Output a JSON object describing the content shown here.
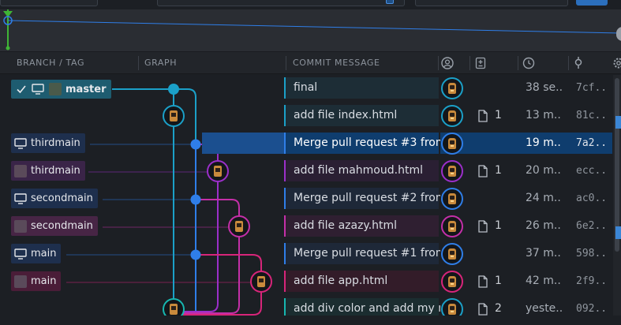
{
  "header": {
    "branch_tag": "BRANCH / TAG",
    "graph": "GRAPH",
    "commit_message": "COMMIT MESSAGE",
    "author_icon": "person-circle-icon",
    "changes_icon": "file-diff-icon",
    "datetime_icon": "clock-icon",
    "sha_icon": "commit-icon",
    "settings_icon": "gear-icon"
  },
  "refs": {
    "master": "master",
    "thirdmain_local": "thirdmain",
    "thirdmain_remote": "thirdmain",
    "secondmain_local": "secondmain",
    "secondmain_remote": "secondmain",
    "main_local": "main",
    "main_remote": "main"
  },
  "colors": {
    "lane_cyan": "#1ba0c8",
    "lane_blue": "#2f7ee8",
    "lane_purple": "#9b2fc9",
    "lane_magenta": "#c42fa8",
    "lane_pink": "#d8257a",
    "lane_teal": "#17b7b0",
    "selection": "#0f3d6e"
  },
  "commits": [
    {
      "message": "final",
      "files": "",
      "time": "38 se...",
      "sha": "7cf..."
    },
    {
      "message": "add file index.html",
      "files": "1",
      "time": "13 m...",
      "sha": "81c..."
    },
    {
      "message": "Merge pull request #3 from",
      "files": "",
      "time": "19 m...",
      "sha": "7a2..."
    },
    {
      "message": "add file mahmoud.html",
      "files": "1",
      "time": "20 m...",
      "sha": "ecc..."
    },
    {
      "message": "Merge pull request #2 from",
      "files": "",
      "time": "24 m...",
      "sha": "ac0..."
    },
    {
      "message": "add file azazy.html",
      "files": "1",
      "time": "26 m...",
      "sha": "6e2..."
    },
    {
      "message": "Merge pull request #1 from",
      "files": "",
      "time": "37 m...",
      "sha": "598..."
    },
    {
      "message": "add file app.html",
      "files": "1",
      "time": "42 m...",
      "sha": "2f9..."
    },
    {
      "message": "add div color and add my n",
      "files": "2",
      "time": "yeste...",
      "sha": "092..."
    }
  ]
}
